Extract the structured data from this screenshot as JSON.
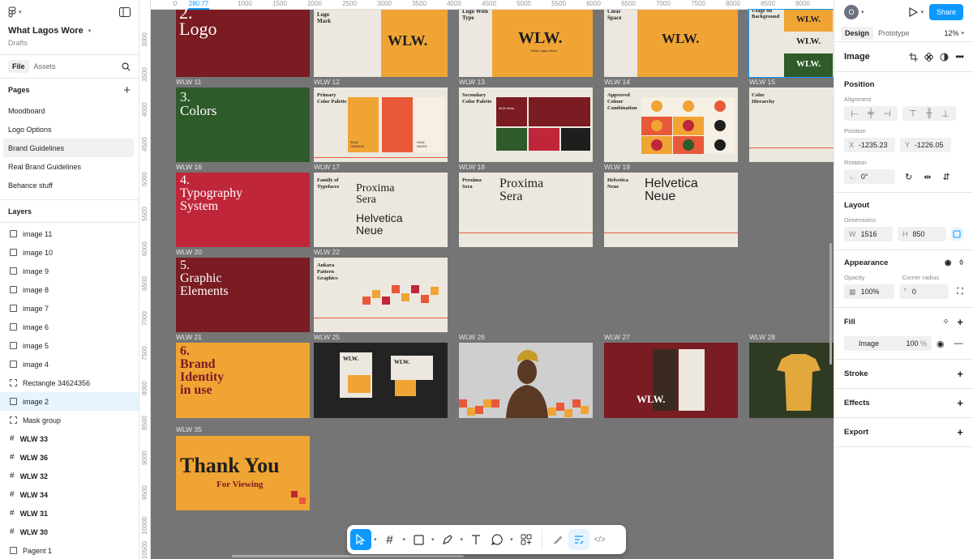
{
  "file": {
    "name": "What Lagos Wore",
    "location": "Drafts"
  },
  "left_tabs": {
    "file": "File",
    "assets": "Assets"
  },
  "pages": {
    "header": "Pages",
    "items": [
      "Moodboard",
      "Logo Options",
      "Brand Guidelines",
      "Real Brand Guidelines",
      "Behance stuff"
    ]
  },
  "layers": {
    "header": "Layers",
    "items": [
      "image 11",
      "image 10",
      "image 9",
      "image 8",
      "image 7",
      "image 6",
      "image 5",
      "image 4",
      "Rectangle 34624356",
      "image 2",
      "Mask group",
      "WLW 33",
      "WLW 36",
      "WLW 32",
      "WLW 34",
      "WLW 31",
      "WLW 30",
      "Pagent 1"
    ]
  },
  "ruler": {
    "top": [
      "0",
      "280.77",
      "1000",
      "1500",
      "2000",
      "2500",
      "3000",
      "3500",
      "4000",
      "4500",
      "5000",
      "5500",
      "6000",
      "6500",
      "7000",
      "7500",
      "8000",
      "8500",
      "9000"
    ],
    "left": [
      "3000",
      "3500",
      "4000",
      "4500",
      "5000",
      "5500",
      "6000",
      "6500",
      "7000",
      "7500",
      "8000",
      "8500",
      "9000",
      "9500",
      "10000",
      "10500"
    ]
  },
  "frames": {
    "labels": [
      "WLW 11",
      "WLW 12",
      "WLW 13",
      "WLW 14",
      "WLW 15",
      "WLW 16",
      "WLW 17",
      "WLW 18",
      "WLW 19",
      "WLW 20",
      "WLW 22",
      "WLW 21",
      "WLW 25",
      "WLW 26",
      "WLW 27",
      "WLW 28",
      "WLW 35"
    ],
    "r0": {
      "logo_title": "2.\nLogo",
      "logo_mark": "Logo\nMark",
      "logo_type": "Logo With\nType",
      "clear_space": "Clear\nSpace",
      "usage": "Usage on\nBackground",
      "wlw": "WLW.",
      "wlw_sub": "What Lagos Wore"
    },
    "colors_title": "3.\nColors",
    "primary_palette": "Primary\nColor Palette",
    "secondary_palette": "Secondary\nColor Palette",
    "approved": "Approved\nColour\nCombination",
    "hierarchy": "Color\nHierarchy",
    "swatch_orange": "WLW\nORANGE",
    "swatch_white": "WLW\nWHITE",
    "swatch_yellow": "WLW Yellow",
    "typo_title": "4.\nTypography\nSystem",
    "families": "Family of\nTypefaces",
    "proxima": "Proxima\nSera",
    "helvetica": "Helvetica\nNeue",
    "graphic_title": "5.\nGraphic\nElements",
    "ankara": "Ankara\nPattern\nGraphics",
    "brand_title": "6.\nBrand\nIdentity\nin use",
    "thanks": "Thank You",
    "thanks_sub": "For Viewing"
  },
  "toolbar": {
    "items": [
      "move-tool",
      "frame-tool",
      "shape-tool",
      "pen-tool",
      "text-tool",
      "comment-tool",
      "actions-tool",
      "draw-mode",
      "design-mode",
      "dev-mode"
    ]
  },
  "right": {
    "avatar": "O",
    "share": "Share",
    "tabs": [
      "Design",
      "Prototype"
    ],
    "zoom": "12%",
    "selection": "Image",
    "position": {
      "header": "Position",
      "alignment": "Alignment",
      "position_label": "Position",
      "x": "-1235.23",
      "y": "-1226.05",
      "rotation_label": "Rotation",
      "rotation": "0°"
    },
    "layout": {
      "header": "Layout",
      "dimensions": "Dimensions",
      "w": "1516",
      "h": "850"
    },
    "appearance": {
      "header": "Appearance",
      "opacity_label": "Opacity",
      "corner_label": "Corner radius",
      "opacity": "100%",
      "corner": "0"
    },
    "fill": {
      "header": "Fill",
      "type": "Image",
      "value": "100",
      "unit": "%"
    },
    "stroke": "Stroke",
    "effects": "Effects",
    "export": "Export"
  },
  "help": "?",
  "colors": {
    "accent": "#0d99ff",
    "orange": "#f0a434",
    "maroon": "#7b1b22",
    "green": "#2f5a2a",
    "red": "#c0263a",
    "cream": "#ece8df",
    "dark": "#232323"
  }
}
